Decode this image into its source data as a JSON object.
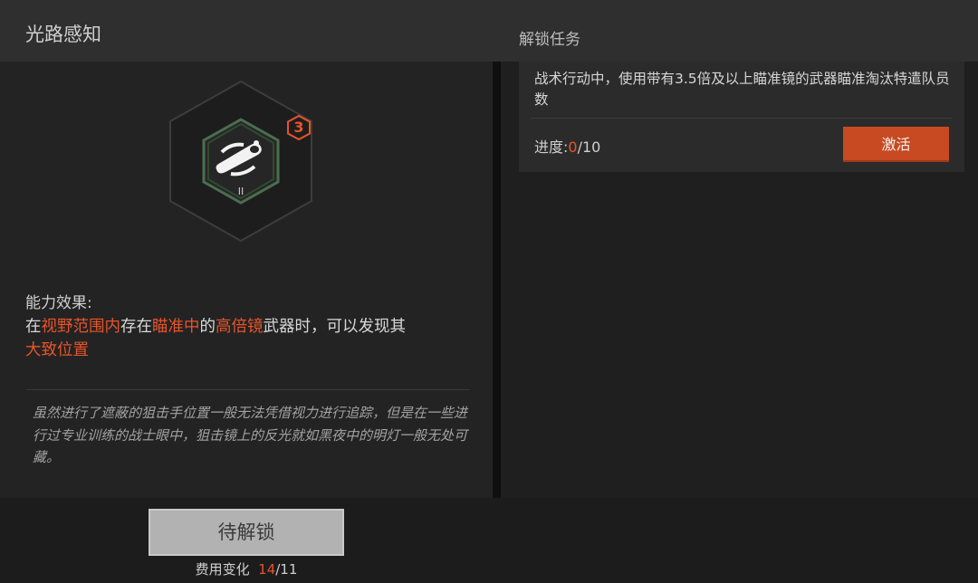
{
  "left_panel": {
    "title": "光路感知",
    "level": "3",
    "icon_tier": "II",
    "effect_label": "能力效果:",
    "effect": {
      "p1": "在",
      "h1": "视野范围内",
      "p2": "存在",
      "h2": "瞄准中",
      "p3": "的",
      "h3": "高倍镜",
      "p4": "武器时，可以发现其",
      "h4": "大致位置"
    },
    "flavor": "虽然进行了遮蔽的狙击手位置一般无法凭借视力进行追踪，但是在一些进行过专业训练的战士眼中，狙击镜上的反光就如黑夜中的明灯一般无处可藏。",
    "unlock_button": "待解锁",
    "cost_label": "费用变化",
    "cost_current": "14",
    "cost_max": "/11"
  },
  "right_panel": {
    "title": "解锁任务",
    "task_description": "战术行动中，使用带有3.5倍及以上瞄准镜的武器瞄准淘汰特遣队员数",
    "progress_label": "进度:",
    "progress_current": "0",
    "progress_total": "/10",
    "activate_button": "激活"
  },
  "colors": {
    "accent": "#e8542a",
    "button_orange": "#c84a22",
    "icon_green": "#5d8a62"
  },
  "icons": [
    "scope-glint-icon",
    "level-hexagon-badge"
  ]
}
